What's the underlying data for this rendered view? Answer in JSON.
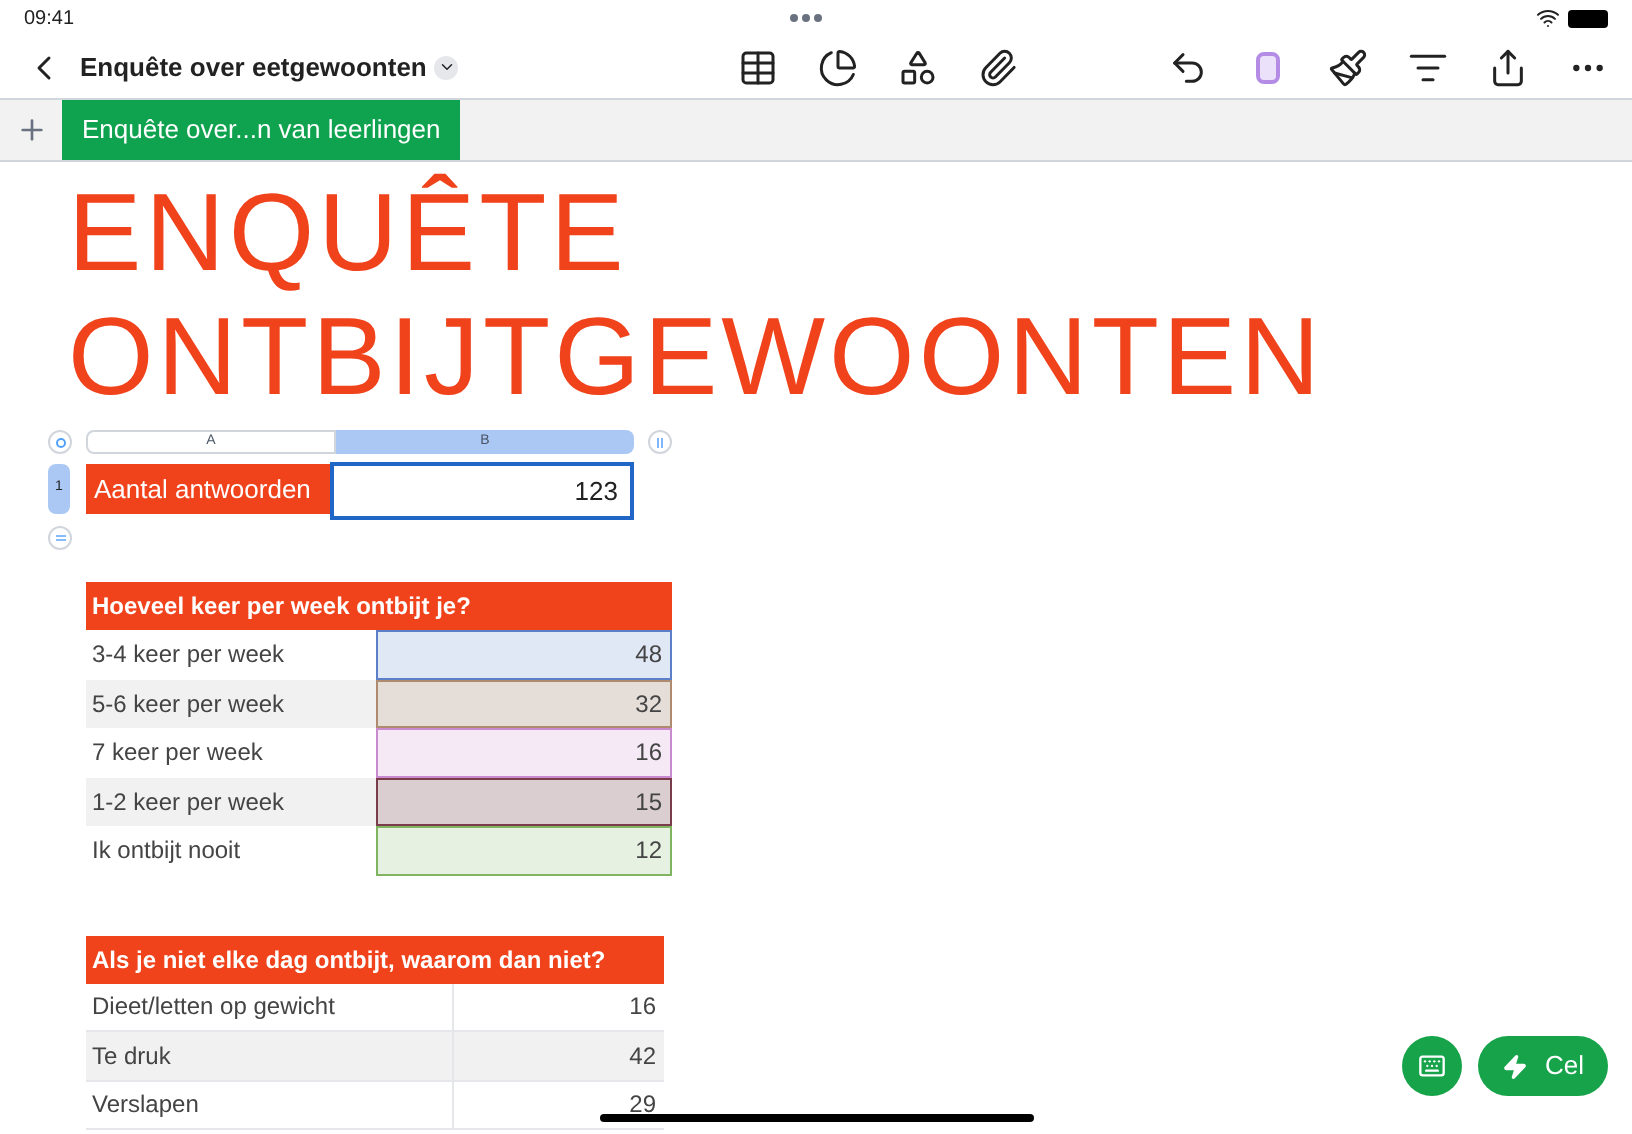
{
  "status_bar": {
    "time": "09:41"
  },
  "toolbar": {
    "document_title": "Enquête over eetgewoonten"
  },
  "sheet_tabs": [
    {
      "label": "Enquête over...n van leerlingen",
      "selected": true
    }
  ],
  "title": [
    "ENQUÊTE",
    "ONTBIJTGEWOONTEN"
  ],
  "summary_table": {
    "columns": [
      {
        "label": "A",
        "selected": false
      },
      {
        "label": "B",
        "selected": true
      }
    ],
    "row_header": "1",
    "label": "Aantal antwoorden",
    "value": "123"
  },
  "frequency_table": {
    "header": "Hoeveel keer per week ontbijt je?",
    "rows": [
      {
        "label": "3-4 keer per week",
        "value": "48",
        "color": "#5b7fc9"
      },
      {
        "label": "5-6 keer per week",
        "value": "32",
        "color": "#b08a6e"
      },
      {
        "label": "7 keer per week",
        "value": "16",
        "color": "#c98ad0"
      },
      {
        "label": "1-2 keer per week",
        "value": "15",
        "color": "#7a3b4a"
      },
      {
        "label": "Ik ontbijt nooit",
        "value": "12",
        "color": "#7fb561"
      }
    ]
  },
  "reasons_table": {
    "header": "Als je niet elke dag ontbijt, waarom dan niet?",
    "rows": [
      {
        "label": "Dieet/letten op gewicht",
        "value": "16"
      },
      {
        "label": "Te druk",
        "value": "42"
      },
      {
        "label": "Verslapen",
        "value": "29"
      }
    ]
  },
  "floating_buttons": {
    "cell_button": "Cel"
  }
}
